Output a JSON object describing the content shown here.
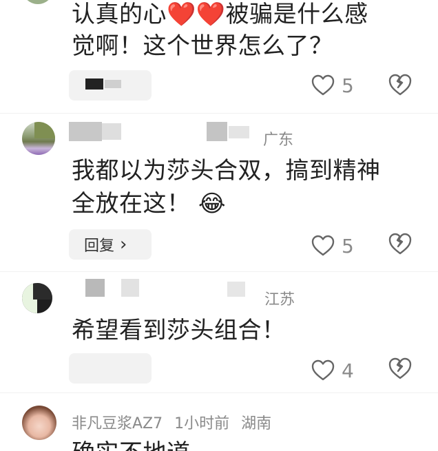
{
  "comments": [
    {
      "text_line1": "认真的心❤️❤️被骗是什么感",
      "text_line2": "觉啊！这个世界怎么了？",
      "likes": "5"
    },
    {
      "location": "广东",
      "text_line1": "我都以为莎头合双，搞到精神",
      "text_line2": "全放在这！",
      "emoji": "😂",
      "reply_label": "回复",
      "reply_chevron": "›",
      "likes": "5"
    },
    {
      "location": "江苏",
      "text_line1": "希望看到莎头组合！",
      "likes": "4"
    },
    {
      "username": "非凡豆浆AZ7",
      "time": "1小时前",
      "location": "湖南",
      "text_line1": "确实不地道"
    }
  ]
}
